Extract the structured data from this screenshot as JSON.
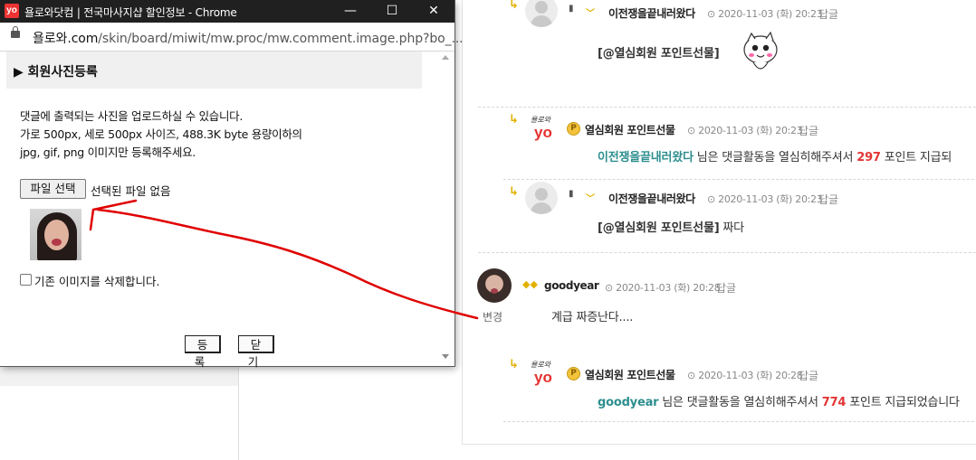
{
  "window": {
    "title": "욜로와닷컴 | 전국마사지샵 할인정보 - Chrome",
    "logo_text": "yo",
    "url_host": "욜로와.com",
    "url_path": "/skin/board/miwit/mw.proc/mw.comment.image.php?bo_...",
    "minimize_glyph": "—",
    "maximize_glyph": "☐",
    "close_glyph": "✕"
  },
  "popup": {
    "section_title": "▶ 회원사진등록",
    "desc_lines": [
      "댓글에 출력되는 사진을 업로드하실 수 있습니다.",
      "가로 500px, 세로 500px 사이즈, 488.3K byte 용량이하의",
      "jpg, gif, png 이미지만 등록해주세요."
    ],
    "file_button": "파일 선택",
    "file_status": "선택된 파일 없음",
    "delete_checkbox_label": "기존 이미지를 삭제합니다.",
    "register_button": "등록",
    "close_button": "닫기"
  },
  "comments": [
    {
      "nick": "이전쟁을끝내러왔다",
      "date": "2020-11-03 (화) 20:23",
      "reply": "답글",
      "mention": "[@열심회원 포인트선물]",
      "text": ""
    },
    {
      "nick": "열심회원 포인트선물",
      "date": "2020-11-03 (화) 20:23",
      "reply": "답글",
      "target": "이전쟁을끝내러왔다",
      "mid": " 님은 댓글활동을 열심히해주셔서 ",
      "points": "297",
      "tail": " 포인트 지급되"
    },
    {
      "nick": "이전쟁을끝내러왔다",
      "date": "2020-11-03 (화) 20:23",
      "reply": "답글",
      "mention": "[@열심회원 포인트선물]",
      "text": " 짜다"
    },
    {
      "nick": "goodyear",
      "date": "2020-11-03 (화) 20:28",
      "reply": "답글",
      "text": "계급 짜증난다....",
      "change_label": "변경"
    },
    {
      "nick": "열심회원 포인트선물",
      "date": "2020-11-03 (화) 20:28",
      "reply": "답글",
      "target": "goodyear",
      "mid": " 님은 댓글활동을 열심히해주셔서 ",
      "points": "774",
      "tail": " 포인트 지급되었습니다"
    }
  ],
  "icons": {
    "reply_arrow": "reply-arrow-icon",
    "point_coin": "P",
    "clock": "clock-icon"
  },
  "colors": {
    "accent_teal": "#2d8e8e",
    "points_red": "#e23535",
    "annotation_red": "#e00000"
  }
}
